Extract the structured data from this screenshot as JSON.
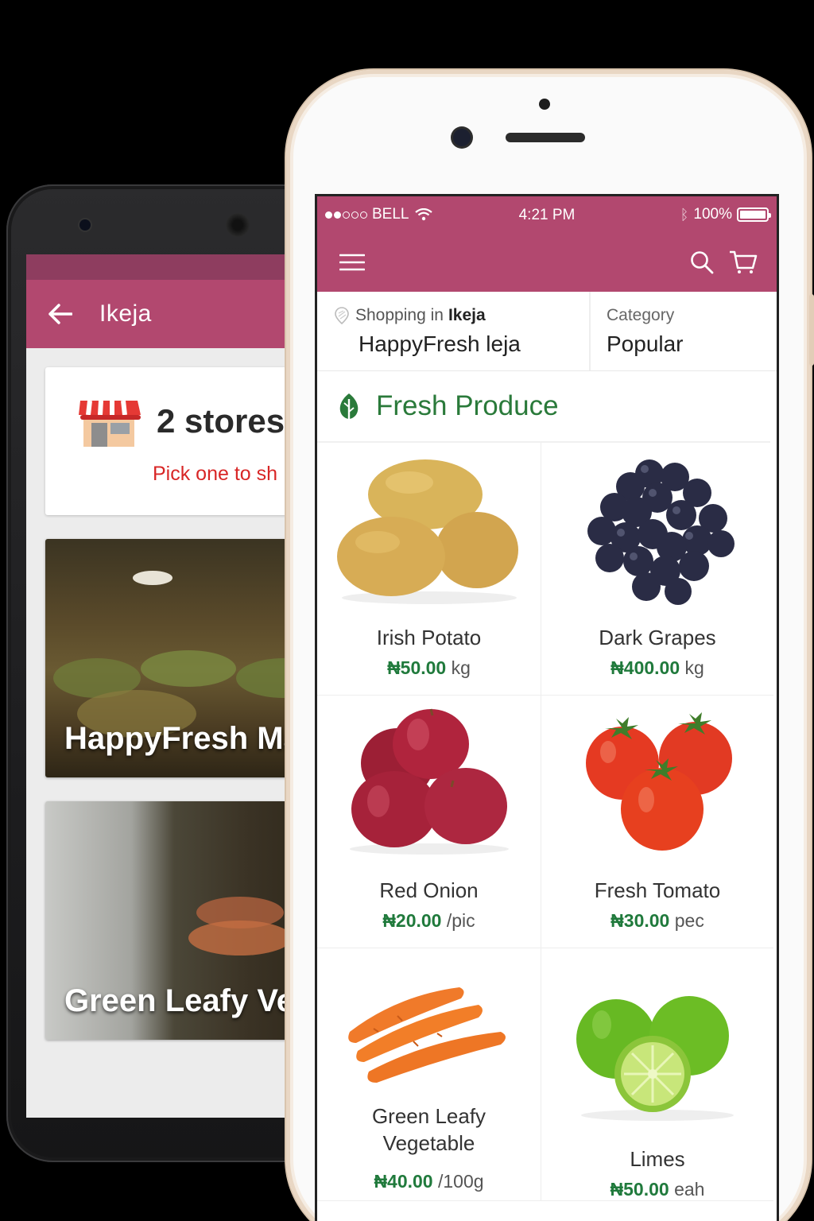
{
  "android": {
    "appbar_title": "Ikeja",
    "stores_count_label": "2 stores",
    "pick_prompt": "Pick one to sh",
    "stores": [
      {
        "name": "HappyFresh Mar"
      },
      {
        "name": "Green Leafy Veg"
      }
    ],
    "colors": {
      "appbar": "#b2486f",
      "statusbar": "#8e3d5f",
      "prompt": "#d82626"
    }
  },
  "iphone": {
    "status": {
      "carrier": "BELL",
      "time": "4:21 PM",
      "battery": "100%"
    },
    "nav": {
      "menu_icon": "hamburger-icon",
      "search_icon": "search-icon",
      "cart_icon": "cart-icon"
    },
    "shopping": {
      "prefix": "Shopping in",
      "area": "Ikeja",
      "store_name": "HappyFresh leja"
    },
    "category": {
      "label": "Category",
      "value": "Popular"
    },
    "section_title": "Fresh Produce",
    "products": [
      {
        "name": "Irish Potato",
        "price": "₦50.00",
        "unit": "kg"
      },
      {
        "name": "Dark Grapes",
        "price": "₦400.00",
        "unit": "kg"
      },
      {
        "name": "Red Onion",
        "price": "₦20.00",
        "unit": "/pic"
      },
      {
        "name": "Fresh Tomato",
        "price": "₦30.00",
        "unit": "pec"
      },
      {
        "name": "Green Leafy Vegetable",
        "price": "₦40.00",
        "unit": "/100g"
      },
      {
        "name": "Limes",
        "price": "₦50.00",
        "unit": "eah"
      }
    ],
    "colors": {
      "brand": "#b2486f",
      "section": "#2a7a3a",
      "price": "#207a3c"
    }
  }
}
